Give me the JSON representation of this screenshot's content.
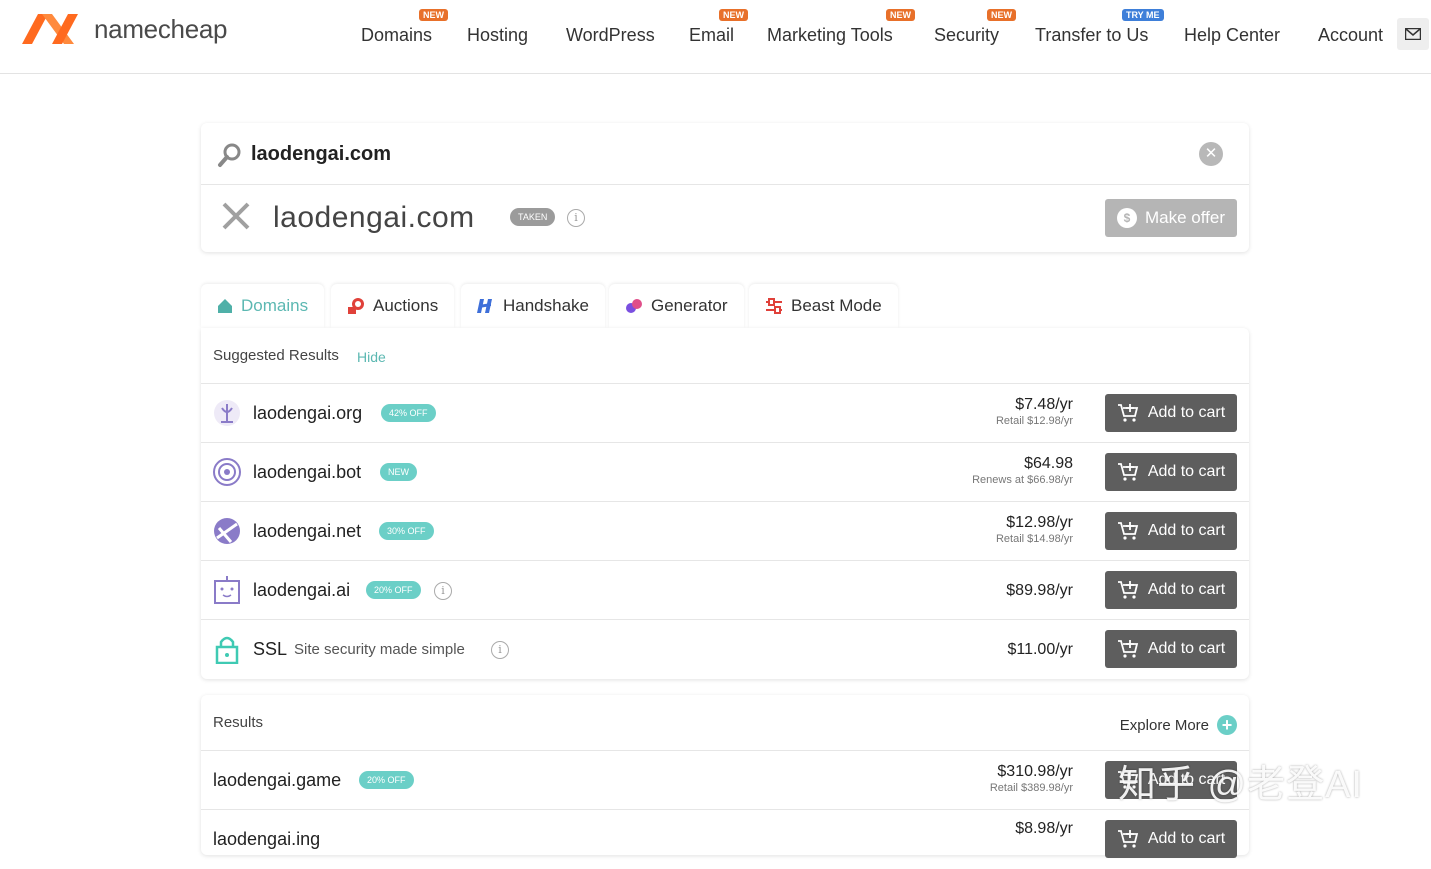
{
  "brand": {
    "name": "namecheap",
    "logo_color": "#ff6a1f"
  },
  "nav": [
    {
      "label": "Domains",
      "badge": "NEW"
    },
    {
      "label": "Hosting",
      "badge": ""
    },
    {
      "label": "WordPress",
      "badge": ""
    },
    {
      "label": "Email",
      "badge": "NEW"
    },
    {
      "label": "Marketing Tools",
      "badge": "NEW"
    },
    {
      "label": "Security",
      "badge": "NEW"
    },
    {
      "label": "Transfer to Us",
      "badge": "TRY ME"
    },
    {
      "label": "Help Center",
      "badge": ""
    },
    {
      "label": "Account",
      "badge": ""
    }
  ],
  "search": {
    "query": "laodengai.com"
  },
  "taken": {
    "domain": "laodengai.com",
    "status": "TAKEN",
    "offer_label": "Make offer"
  },
  "tabs": [
    {
      "label": "Domains",
      "icon": "house-icon",
      "active": true
    },
    {
      "label": "Auctions",
      "icon": "gavel-icon"
    },
    {
      "label": "Handshake",
      "icon": "handshake-icon"
    },
    {
      "label": "Generator",
      "icon": "generator-icon"
    },
    {
      "label": "Beast Mode",
      "icon": "sliders-icon"
    }
  ],
  "suggested": {
    "title": "Suggested Results",
    "hide_label": "Hide",
    "rows": [
      {
        "name": "laodengai.org",
        "pill": "42% OFF",
        "price": "$7.48/yr",
        "sub": "Retail $12.98/yr",
        "button": "Add to cart"
      },
      {
        "name": "laodengai.bot",
        "pill": "NEW",
        "price": "$64.98",
        "sub": "Renews at $66.98/yr",
        "button": "Add to cart"
      },
      {
        "name": "laodengai.net",
        "pill": "30% OFF",
        "price": "$12.98/yr",
        "sub": "Retail $14.98/yr",
        "button": "Add to cart"
      },
      {
        "name": "laodengai.ai",
        "pill": "20% OFF",
        "price": "$89.98/yr",
        "sub": "",
        "button": "Add to cart"
      },
      {
        "name": "SSL",
        "desc": "Site security made simple",
        "price": "$11.00/yr",
        "sub": "",
        "button": "Add to cart"
      }
    ]
  },
  "results": {
    "title": "Results",
    "explore_label": "Explore More",
    "rows": [
      {
        "name": "laodengai.game",
        "pill": "20% OFF",
        "price": "$310.98/yr",
        "sub": "Retail $389.98/yr",
        "button": "Add to cart"
      },
      {
        "name": "laodengai.ing",
        "pill": "",
        "price": "$8.98/yr",
        "sub": "",
        "button": "Add to cart"
      }
    ]
  },
  "watermark": "知乎 @老登AI",
  "colors": {
    "accent": "#6bcfc7",
    "cart_button": "#5e5e5e",
    "badge_orange": "#e8702a",
    "badge_blue": "#3e7fd9"
  }
}
